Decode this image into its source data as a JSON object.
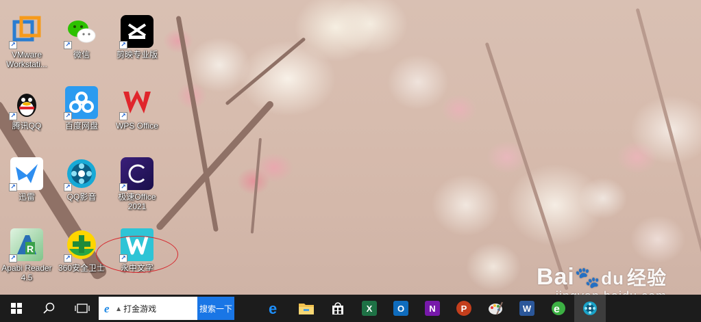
{
  "desktop": {
    "icons": [
      {
        "label": "VMware Workstati...",
        "icon": "vmware-icon"
      },
      {
        "label": "微信",
        "icon": "wechat-icon"
      },
      {
        "label": "剪映专业版",
        "icon": "capcut-icon"
      },
      {
        "label": "腾讯QQ",
        "icon": "qq-icon"
      },
      {
        "label": "百度网盘",
        "icon": "baidu-netdisk-icon"
      },
      {
        "label": "WPS Office",
        "icon": "wps-icon"
      },
      {
        "label": "迅雷",
        "icon": "thunder-icon"
      },
      {
        "label": "QQ影音",
        "icon": "qq-player-icon"
      },
      {
        "label": "极速Office 2021",
        "icon": "jisu-office-icon"
      },
      {
        "label": "Apabi Reader 4.5",
        "icon": "apabi-icon"
      },
      {
        "label": "360安全卫士",
        "icon": "360-icon"
      },
      {
        "label": "永中文字",
        "icon": "yozo-writer-icon"
      }
    ],
    "shortcut_glyph": "↗"
  },
  "watermark": {
    "top": "Bai",
    "top_mid": "du",
    "top_cn": "经验",
    "bottom": "jingyan.baidu.com"
  },
  "taskbar": {
    "search_text": "打金游戏",
    "search_button": "搜索一下",
    "apps": [
      {
        "name": "edge",
        "glyph": "e",
        "color": "#1e90ff"
      },
      {
        "name": "file-explorer",
        "glyph": "",
        "color": "#f2c14e"
      },
      {
        "name": "store",
        "glyph": "",
        "color": "#ffffff"
      },
      {
        "name": "excel",
        "glyph": "X",
        "color": "#1e7145"
      },
      {
        "name": "outlook",
        "glyph": "O",
        "color": "#0f6cbd"
      },
      {
        "name": "onenote",
        "glyph": "N",
        "color": "#7719aa"
      },
      {
        "name": "powerpoint",
        "glyph": "P",
        "color": "#c43e1c"
      },
      {
        "name": "paint",
        "glyph": "",
        "color": "#e8e8e8"
      },
      {
        "name": "word",
        "glyph": "W",
        "color": "#2b579a"
      },
      {
        "name": "360-browser",
        "glyph": "e",
        "color": "#3cb043"
      },
      {
        "name": "qq-player",
        "glyph": "",
        "color": "#1aa3c8"
      }
    ]
  }
}
